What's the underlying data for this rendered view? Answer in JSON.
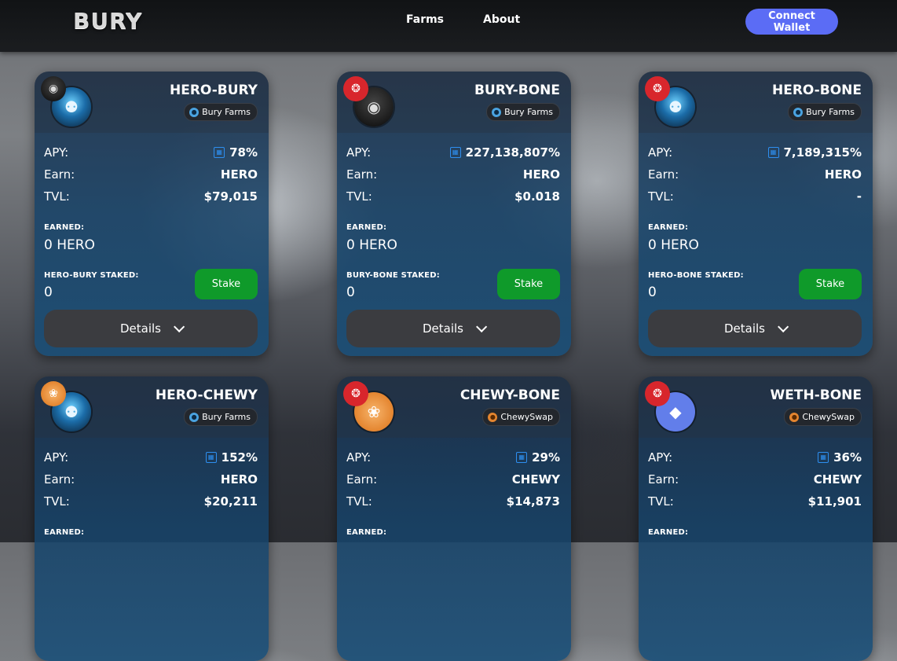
{
  "header": {
    "logo": "BURY",
    "nav": [
      {
        "label": "Farms"
      },
      {
        "label": "About"
      }
    ],
    "connect_label": "Connect Wallet"
  },
  "cards": [
    {
      "pair": "HERO-BURY",
      "source": "Bury Farms",
      "source_icon": "bury-farms-icon",
      "small_token": "bury",
      "big_token": "hero",
      "apy_label": "APY:",
      "apy": "78%",
      "earn_label": "Earn:",
      "earn": "HERO",
      "tvl_label": "TVL:",
      "tvl": "$79,015",
      "earned_label": "EARNED:",
      "earned": "0 HERO",
      "staked_label": "HERO-BURY STAKED:",
      "staked": "0",
      "stake_label": "Stake",
      "details_label": "Details"
    },
    {
      "pair": "BURY-BONE",
      "source": "Bury Farms",
      "source_icon": "bury-farms-icon",
      "small_token": "bone",
      "big_token": "bury",
      "apy_label": "APY:",
      "apy": "227,138,807%",
      "earn_label": "Earn:",
      "earn": "HERO",
      "tvl_label": "TVL:",
      "tvl": "$0.018",
      "earned_label": "EARNED:",
      "earned": "0 HERO",
      "staked_label": "BURY-BONE STAKED:",
      "staked": "0",
      "stake_label": "Stake",
      "details_label": "Details"
    },
    {
      "pair": "HERO-BONE",
      "source": "Bury Farms",
      "source_icon": "bury-farms-icon",
      "small_token": "bone",
      "big_token": "hero",
      "apy_label": "APY:",
      "apy": "7,189,315%",
      "earn_label": "Earn:",
      "earn": "HERO",
      "tvl_label": "TVL:",
      "tvl": "-",
      "earned_label": "EARNED:",
      "earned": "0 HERO",
      "staked_label": "HERO-BONE STAKED:",
      "staked": "0",
      "stake_label": "Stake",
      "details_label": "Details"
    },
    {
      "pair": "HERO-CHEWY",
      "source": "Bury Farms",
      "source_icon": "bury-farms-icon",
      "small_token": "chewy",
      "big_token": "hero",
      "apy_label": "APY:",
      "apy": "152%",
      "earn_label": "Earn:",
      "earn": "HERO",
      "tvl_label": "TVL:",
      "tvl": "$20,211",
      "earned_label": "EARNED:"
    },
    {
      "pair": "CHEWY-BONE",
      "source": "ChewySwap",
      "source_icon": "chewyswap-icon",
      "small_token": "bone",
      "big_token": "chewy",
      "apy_label": "APY:",
      "apy": "29%",
      "earn_label": "Earn:",
      "earn": "CHEWY",
      "tvl_label": "TVL:",
      "tvl": "$14,873",
      "earned_label": "EARNED:"
    },
    {
      "pair": "WETH-BONE",
      "source": "ChewySwap",
      "source_icon": "chewyswap-icon",
      "small_token": "bone",
      "big_token": "eth",
      "apy_label": "APY:",
      "apy": "36%",
      "earn_label": "Earn:",
      "earn": "CHEWY",
      "tvl_label": "TVL:",
      "tvl": "$11,901",
      "earned_label": "EARNED:"
    }
  ],
  "icons": {
    "calculator": "calculator-icon",
    "chevron": "chevron-down-icon"
  },
  "colors": {
    "accent": "#5b6cf5",
    "stake": "#0f9a2a",
    "calc": "#2e8ff0"
  }
}
